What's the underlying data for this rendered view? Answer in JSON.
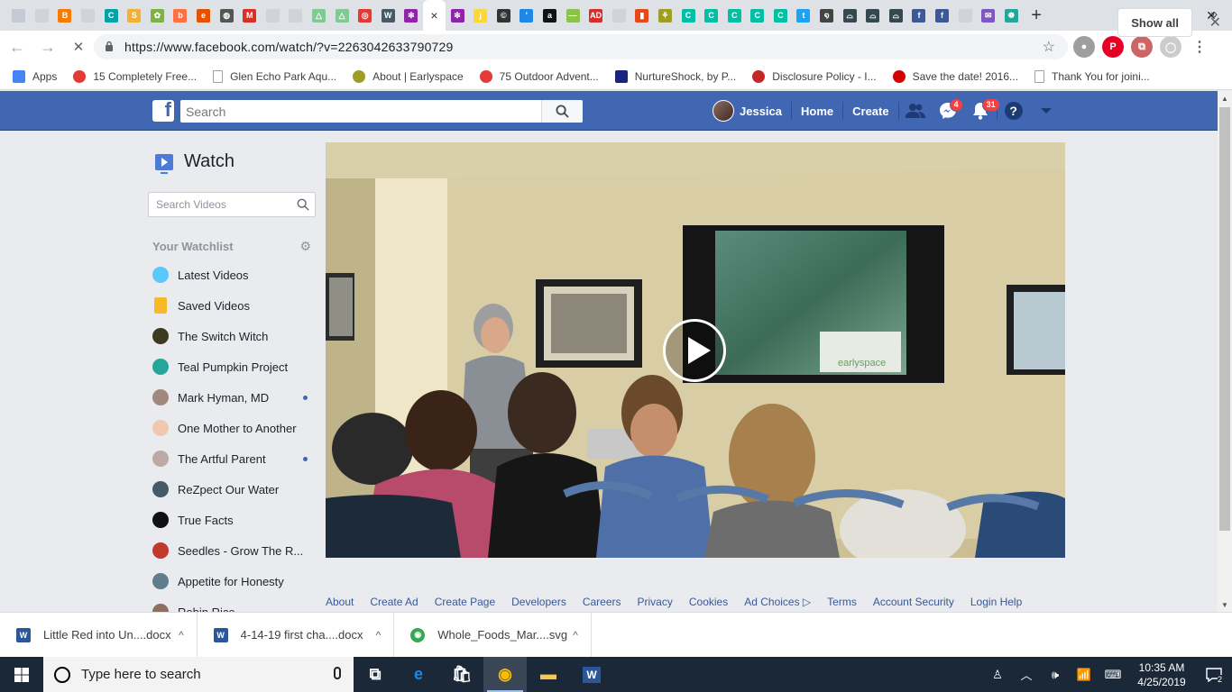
{
  "browser": {
    "tab_favicons": [
      {
        "icon": "page-icon",
        "color": "#c4c9d4",
        "glyph": ""
      },
      {
        "icon": "doc-icon",
        "color": "#d0d4da",
        "glyph": ""
      },
      {
        "icon": "blogger-icon",
        "color": "#f57c00",
        "glyph": "B"
      },
      {
        "icon": "doc-icon",
        "color": "#d0d4da",
        "glyph": ""
      },
      {
        "icon": "c-icon",
        "color": "#00a4a6",
        "glyph": "C"
      },
      {
        "icon": "s-icon",
        "color": "#f2b134",
        "glyph": "S"
      },
      {
        "icon": "tree-icon",
        "color": "#7cb342",
        "glyph": "✿"
      },
      {
        "icon": "b-icon",
        "color": "#ff7043",
        "glyph": "b"
      },
      {
        "icon": "e-icon",
        "color": "#e65100",
        "glyph": "e"
      },
      {
        "icon": "globe-icon",
        "color": "#555",
        "glyph": "◍"
      },
      {
        "icon": "gmail-icon",
        "color": "#d93025",
        "glyph": "M"
      },
      {
        "icon": "doc-icon",
        "color": "#d0d4da",
        "glyph": ""
      },
      {
        "icon": "doc-icon",
        "color": "#d0d4da",
        "glyph": ""
      },
      {
        "icon": "drive-icon",
        "color": "#81c995",
        "glyph": "△"
      },
      {
        "icon": "drive-icon",
        "color": "#81c995",
        "glyph": "△"
      },
      {
        "icon": "swirl-icon",
        "color": "#e53935",
        "glyph": "◎"
      },
      {
        "icon": "well-icon",
        "color": "#455a64",
        "glyph": "W"
      },
      {
        "icon": "palm-icon",
        "color": "#8e24aa",
        "glyph": "✻"
      },
      {
        "icon": "close-icon",
        "color": "#ffffff",
        "glyph": "×"
      },
      {
        "icon": "palm-icon",
        "color": "#8e24aa",
        "glyph": "✻"
      },
      {
        "icon": "jff-icon",
        "color": "#fdd835",
        "glyph": "j"
      },
      {
        "icon": "circle-c-icon",
        "color": "#333",
        "glyph": "©"
      },
      {
        "icon": "feather-icon",
        "color": "#1e88e5",
        "glyph": "'"
      },
      {
        "icon": "amazon-icon",
        "color": "#111",
        "glyph": "a"
      },
      {
        "icon": "dash-icon",
        "color": "#8bc34a",
        "glyph": "—"
      },
      {
        "icon": "ad-icon",
        "color": "#d32f2f",
        "glyph": "AD"
      },
      {
        "icon": "doc-icon",
        "color": "#d0d4da",
        "glyph": ""
      },
      {
        "icon": "office-icon",
        "color": "#e64a19",
        "glyph": "▮"
      },
      {
        "icon": "earlyspace-icon",
        "color": "#9e9d24",
        "glyph": "⚘"
      },
      {
        "icon": "c-icon",
        "color": "#00bfa5",
        "glyph": "C"
      },
      {
        "icon": "c-icon",
        "color": "#00bfa5",
        "glyph": "C"
      },
      {
        "icon": "c-icon",
        "color": "#00bfa5",
        "glyph": "C"
      },
      {
        "icon": "c-icon",
        "color": "#00bfa5",
        "glyph": "C"
      },
      {
        "icon": "c-icon",
        "color": "#00bfa5",
        "glyph": "C"
      },
      {
        "icon": "twitter-icon",
        "color": "#1da1f2",
        "glyph": "t"
      },
      {
        "icon": "spiral-icon",
        "color": "#444",
        "glyph": "໑"
      },
      {
        "icon": "bridge-icon",
        "color": "#37474f",
        "glyph": "⌓"
      },
      {
        "icon": "bridge-icon",
        "color": "#37474f",
        "glyph": "⌓"
      },
      {
        "icon": "bridge-icon",
        "color": "#37474f",
        "glyph": "⌓"
      },
      {
        "icon": "facebook-icon",
        "color": "#3b5998",
        "glyph": "f"
      },
      {
        "icon": "facebook-icon",
        "color": "#3b5998",
        "glyph": "f"
      },
      {
        "icon": "doc-icon",
        "color": "#d0d4da",
        "glyph": ""
      },
      {
        "icon": "mail-icon",
        "color": "#7e57c2",
        "glyph": "✉"
      },
      {
        "icon": "yoga-icon",
        "color": "#26a69a",
        "glyph": "☸"
      }
    ],
    "active_tab_index": 18,
    "new_tab": "+",
    "window_controls": {
      "minimize": "—",
      "restore": "❐",
      "close": "✕"
    },
    "nav": {
      "back": "←",
      "forward": "→",
      "reload": "✕"
    },
    "url": "https://www.facebook.com/watch/?v=2263042633790729",
    "bookmarks": [
      {
        "label": "Apps",
        "icon": "apps-grid-icon",
        "color": "#4285f4"
      },
      {
        "label": "15 Completely Free...",
        "icon": "red-circle-icon",
        "color": "#e53935"
      },
      {
        "label": "Glen Echo Park Aqu...",
        "icon": "page-icon",
        "color": "#9aa0a6"
      },
      {
        "label": "About | Earlyspace",
        "icon": "earlyspace-icon",
        "color": "#9e9d24"
      },
      {
        "label": "75 Outdoor Advent...",
        "icon": "red-circle-icon",
        "color": "#e53935"
      },
      {
        "label": "NurtureShock, by P...",
        "icon": "grid-icon",
        "color": "#1a237e"
      },
      {
        "label": "Disclosure Policy - I...",
        "icon": "card-icon",
        "color": "#c62828"
      },
      {
        "label": "Save the date! 2016...",
        "icon": "pen-icon",
        "color": "#d50000"
      },
      {
        "label": "Thank You for joini...",
        "icon": "page-icon",
        "color": "#9aa0a6"
      }
    ],
    "bookmarks_more": "»",
    "extensions": [
      {
        "icon": "record-icon",
        "color": "#9e9e9e",
        "glyph": "●"
      },
      {
        "icon": "pinterest-icon",
        "color": "#e60023",
        "glyph": "P"
      },
      {
        "icon": "pdf-icon",
        "color": "#c66",
        "glyph": "⧉"
      },
      {
        "icon": "profile-icon",
        "color": "#ccc",
        "glyph": "◯"
      },
      {
        "icon": "menu-icon",
        "color": "#ffffff",
        "glyph": "⋮"
      }
    ]
  },
  "facebook": {
    "search_placeholder": "Search",
    "user_name": "Jessica",
    "home": "Home",
    "create": "Create",
    "messenger_badge": "4",
    "notifications_badge": "31",
    "help": "?",
    "brand_color": "#4267b2"
  },
  "watch": {
    "title": "Watch",
    "search_placeholder": "Search Videos",
    "watchlist_title": "Your Watchlist",
    "watchlist": [
      {
        "label": "Latest Videos",
        "icon": "play-circle-icon",
        "color": "#5ac8fa",
        "dot": false
      },
      {
        "label": "Saved Videos",
        "icon": "bookmark-icon",
        "color": "#f7b928",
        "dot": false
      },
      {
        "label": "The Switch Witch",
        "icon": "avatar",
        "color": "#3e3a1f",
        "dot": false
      },
      {
        "label": "Teal Pumpkin Project",
        "icon": "avatar",
        "color": "#26a69a",
        "dot": false
      },
      {
        "label": "Mark Hyman, MD",
        "icon": "avatar",
        "color": "#a1887f",
        "dot": true
      },
      {
        "label": "One Mother to Another",
        "icon": "avatar",
        "color": "#f0c8b0",
        "dot": false
      },
      {
        "label": "The Artful Parent",
        "icon": "avatar",
        "color": "#bcaaa4",
        "dot": true
      },
      {
        "label": "ReZpect Our Water",
        "icon": "avatar",
        "color": "#455a64",
        "dot": false
      },
      {
        "label": "True Facts",
        "icon": "avatar",
        "color": "#111111",
        "dot": false
      },
      {
        "label": "Seedles - Grow The R...",
        "icon": "avatar",
        "color": "#c0392b",
        "dot": false
      },
      {
        "label": "Appetite for Honesty",
        "icon": "avatar",
        "color": "#607d8b",
        "dot": false
      },
      {
        "label": "Robin Rice",
        "icon": "avatar",
        "color": "#8d6e63",
        "dot": false
      }
    ],
    "screen_slide_text": "earlyspace",
    "footer": [
      "About",
      "Create Ad",
      "Create Page",
      "Developers",
      "Careers",
      "Privacy",
      "Cookies",
      "Ad Choices ▷",
      "Terms",
      "Account Security",
      "Login Help"
    ]
  },
  "downloads": {
    "items": [
      {
        "name": "Little Red into Un....docx",
        "icon": "word-doc-icon",
        "color": "#2b579a",
        "glyph": "W"
      },
      {
        "name": "4-14-19 first cha....docx",
        "icon": "word-doc-icon",
        "color": "#2b579a",
        "glyph": "W"
      },
      {
        "name": "Whole_Foods_Mar....svg",
        "icon": "chrome-icon",
        "color": "#34a853",
        "glyph": "◉"
      }
    ],
    "caret": "^",
    "show_all": "Show all",
    "close": "✕"
  },
  "taskbar": {
    "search_placeholder": "Type here to search",
    "apps": [
      {
        "icon": "task-view-icon",
        "color": "#ffffff",
        "glyph": "⧉",
        "active": false
      },
      {
        "icon": "edge-icon",
        "color": "#1e88e5",
        "glyph": "e",
        "active": false
      },
      {
        "icon": "store-icon",
        "color": "#ffffff",
        "glyph": "🛍",
        "active": false
      },
      {
        "icon": "chrome-icon",
        "color": "#fbbc05",
        "glyph": "◉",
        "active": true
      },
      {
        "icon": "file-explorer-icon",
        "color": "#f9c74f",
        "glyph": "▬",
        "active": false
      },
      {
        "icon": "word-icon",
        "color": "#2b579a",
        "glyph": "W",
        "active": false
      }
    ],
    "tray_icons": [
      "person-icon",
      "chevron-up-icon",
      "volume-icon",
      "wifi-icon",
      "keyboard-icon"
    ],
    "time": "10:35 AM",
    "date": "4/25/2019",
    "notification_count": "2"
  }
}
